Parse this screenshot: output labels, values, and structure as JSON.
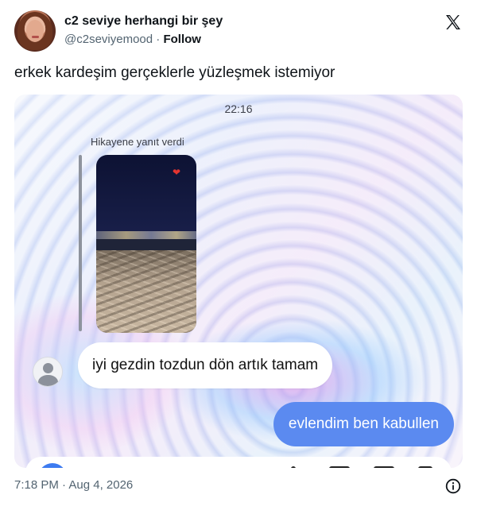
{
  "tweet": {
    "display_name": "c2 seviye herhangi bir şey",
    "handle": "@c2seviyemood",
    "separator": " · ",
    "follow_label": "Follow",
    "text": "erkek kardeşim gerçeklerle yüzleşmek istemiyor",
    "timestamp": "7:18 PM · Aug 4, 2026"
  },
  "chat": {
    "time": "22:16",
    "story_reply_label": "Hikayene yanıt verdi",
    "incoming_message": "iyi gezdin tozdun dön artık tamam",
    "outgoing_message": "evlendim ben kabullen"
  },
  "colors": {
    "outgoing_bubble": "#5b8af0",
    "text_primary": "#0f1419",
    "text_secondary": "#536471"
  },
  "icons": {
    "brand": "x-logo-icon",
    "info": "info-icon",
    "story_reaction": "heart-icon",
    "default_avatar": "person-icon"
  }
}
